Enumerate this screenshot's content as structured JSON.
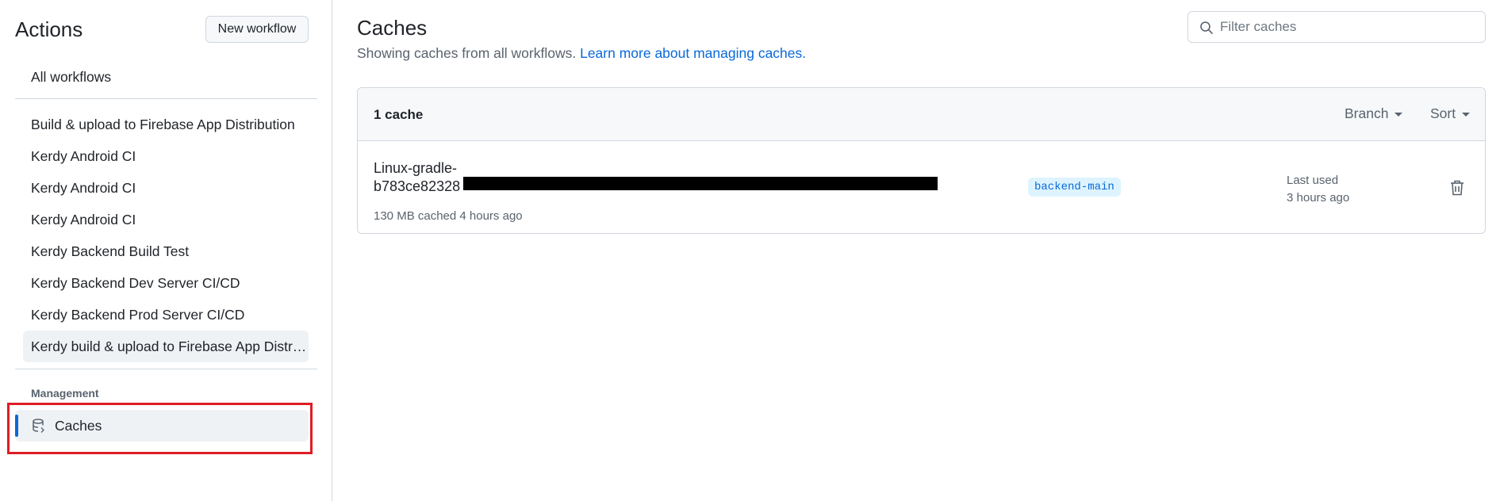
{
  "sidebar": {
    "title": "Actions",
    "new_workflow_label": "New workflow",
    "all_workflows_label": "All workflows",
    "workflows": [
      "Build & upload to Firebase App Distribution",
      "Kerdy Android CI",
      "Kerdy Android CI",
      "Kerdy Android CI",
      "Kerdy Backend Build Test",
      "Kerdy Backend Dev Server CI/CD",
      "Kerdy Backend Prod Server CI/CD",
      "Kerdy build & upload to Firebase App Distribution"
    ],
    "management_label": "Management",
    "caches_label": "Caches"
  },
  "main": {
    "title": "Caches",
    "subtitle_text": "Showing caches from all workflows.",
    "subtitle_link": "Learn more about managing caches.",
    "filter_placeholder": "Filter caches",
    "count_label": "1 cache",
    "branch_dropdown": "Branch",
    "sort_dropdown": "Sort",
    "caches": [
      {
        "name_line1": "Linux-gradle-",
        "name_line2": "b783ce82328",
        "meta": "130 MB cached 4 hours ago",
        "branch": "backend-main",
        "last_used_label": "Last used",
        "last_used_value": "3 hours ago"
      }
    ]
  },
  "colors": {
    "accent": "#0969da",
    "highlight": "#e01c24",
    "selected_bg": "#eff2f5"
  },
  "icons": [
    "search-icon",
    "database-icon",
    "trash-icon",
    "caret-down-icon"
  ]
}
